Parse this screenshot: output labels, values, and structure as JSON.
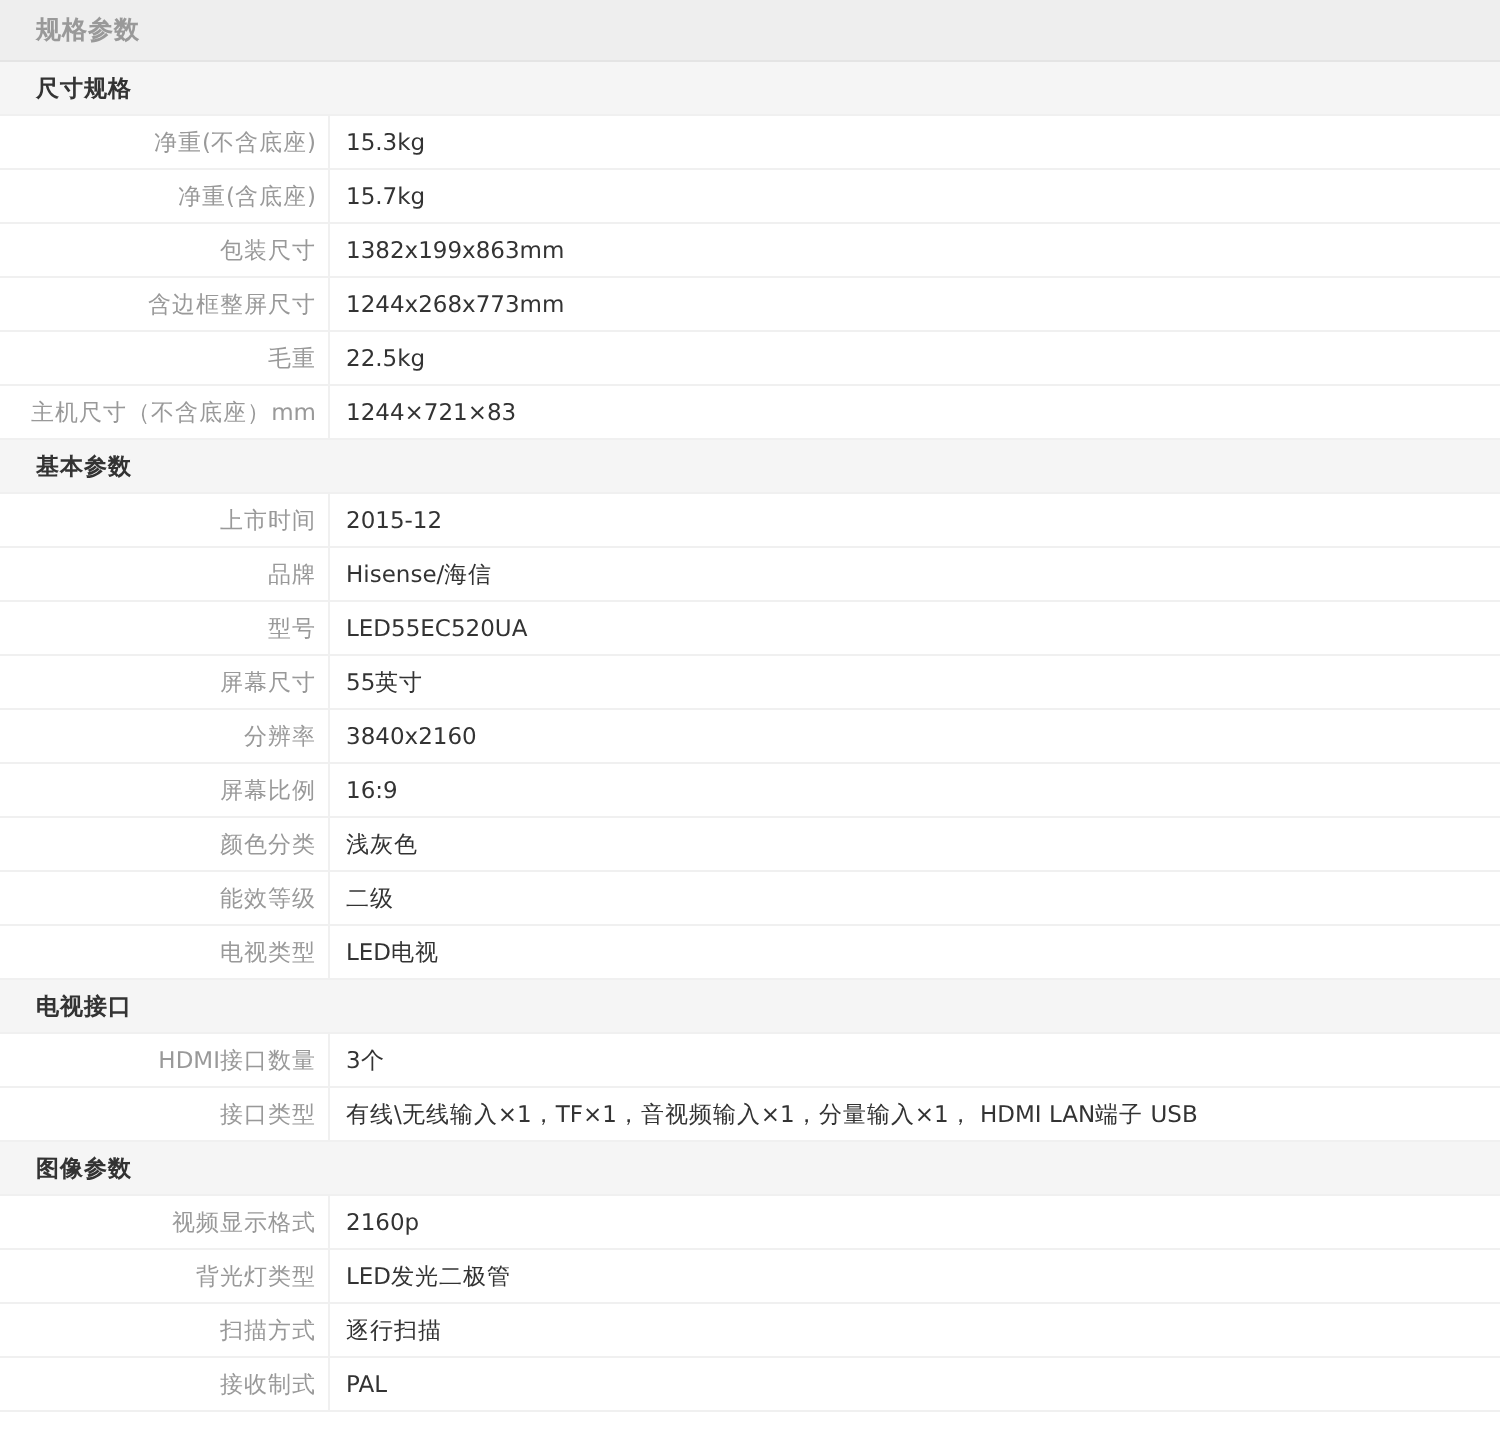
{
  "title": "规格参数",
  "sections": [
    {
      "name": "尺寸规格",
      "rows": [
        {
          "label": "净重(不含底座)",
          "value": "15.3kg"
        },
        {
          "label": "净重(含底座)",
          "value": "15.7kg"
        },
        {
          "label": "包装尺寸",
          "value": "1382x199x863mm"
        },
        {
          "label": "含边框整屏尺寸",
          "value": "1244x268x773mm"
        },
        {
          "label": "毛重",
          "value": "22.5kg"
        },
        {
          "label": "主机尺寸（不含底座）mm",
          "value": "1244×721×83"
        }
      ]
    },
    {
      "name": "基本参数",
      "rows": [
        {
          "label": "上市时间",
          "value": "2015-12"
        },
        {
          "label": "品牌",
          "value": "Hisense/海信"
        },
        {
          "label": "型号",
          "value": "LED55EC520UA"
        },
        {
          "label": "屏幕尺寸",
          "value": "55英寸"
        },
        {
          "label": "分辨率",
          "value": "3840x2160"
        },
        {
          "label": "屏幕比例",
          "value": "16:9"
        },
        {
          "label": "颜色分类",
          "value": "浅灰色"
        },
        {
          "label": "能效等级",
          "value": "二级"
        },
        {
          "label": "电视类型",
          "value": "LED电视"
        }
      ]
    },
    {
      "name": "电视接口",
      "rows": [
        {
          "label": "HDMI接口数量",
          "value": "3个"
        },
        {
          "label": "接口类型",
          "value": "有线\\无线输入×1，TF×1，音视频输入×1，分量输入×1， HDMI LAN端子 USB"
        }
      ]
    },
    {
      "name": "图像参数",
      "rows": [
        {
          "label": "视频显示格式",
          "value": "2160p"
        },
        {
          "label": "背光灯类型",
          "value": "LED发光二极管"
        },
        {
          "label": "扫描方式",
          "value": "逐行扫描"
        },
        {
          "label": "接收制式",
          "value": "PAL"
        }
      ]
    }
  ]
}
